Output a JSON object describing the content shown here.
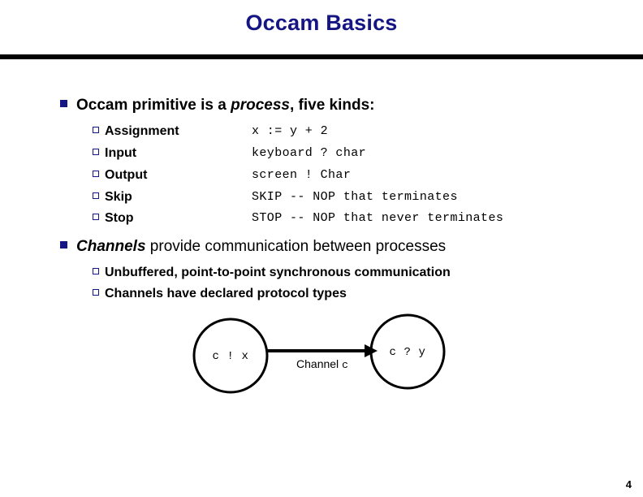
{
  "slide": {
    "title": "Occam Basics",
    "page_number": "4",
    "accent_color": "#151583",
    "rule_color": "#000000",
    "background_color": "#ffffff"
  },
  "bullets": [
    {
      "marker": "filled-square",
      "parts": [
        {
          "text": "Occam primitive is a ",
          "style": "bold"
        },
        {
          "text": "process",
          "style": "bold-italic"
        },
        {
          "text": ", five kinds:",
          "style": "bold"
        }
      ]
    },
    {
      "marker": "filled-square",
      "parts": [
        {
          "text": "Channels",
          "style": "bold-italic"
        },
        {
          "text": " provide communication between processes",
          "style": "regular"
        }
      ]
    }
  ],
  "primitives": {
    "rows": [
      {
        "name": "Assignment",
        "code": "x := y + 2"
      },
      {
        "name": "Input",
        "code": "keyboard ? char"
      },
      {
        "name": "Output",
        "code": "screen ! Char"
      },
      {
        "name": "Skip",
        "code": "SKIP -- NOP that terminates"
      },
      {
        "name": "Stop",
        "code": "STOP -- NOP that never terminates"
      }
    ]
  },
  "channel_points": [
    "Unbuffered, point-to-point synchronous communication",
    "Channels have declared protocol types"
  ],
  "diagram": {
    "left_node_label": "c ! x",
    "right_node_label": "c ? y",
    "arrow_label_word": "Channel",
    "arrow_label_mono": "c"
  }
}
